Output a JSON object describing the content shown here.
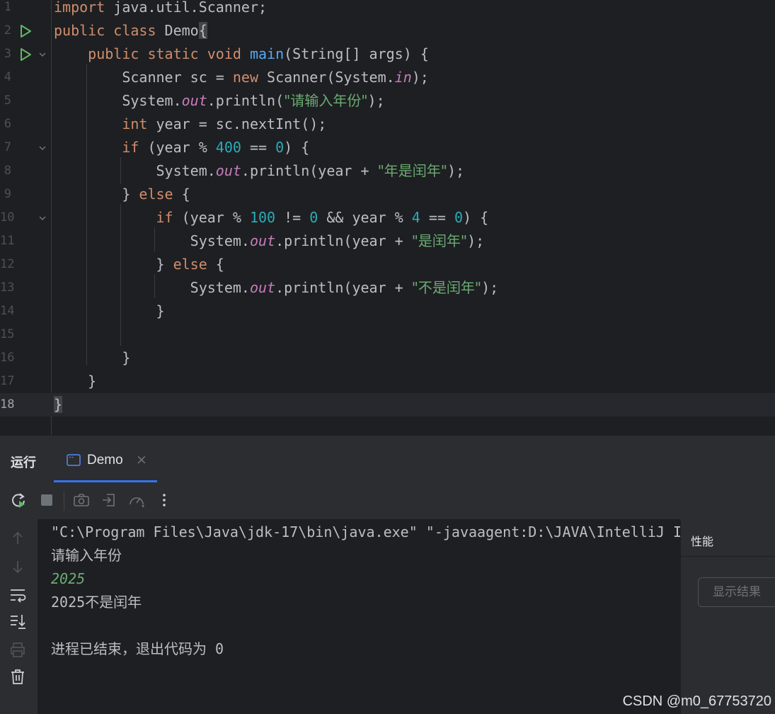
{
  "editor": {
    "lines": [
      {
        "num": "1"
      },
      {
        "num": "2"
      },
      {
        "num": "3"
      },
      {
        "num": "4"
      },
      {
        "num": "5"
      },
      {
        "num": "6"
      },
      {
        "num": "7"
      },
      {
        "num": "8"
      },
      {
        "num": "9"
      },
      {
        "num": "10"
      },
      {
        "num": "11"
      },
      {
        "num": "12"
      },
      {
        "num": "13"
      },
      {
        "num": "14"
      },
      {
        "num": "15"
      },
      {
        "num": "16"
      },
      {
        "num": "17"
      },
      {
        "num": "18"
      }
    ],
    "code": {
      "l1": {
        "kw": "import",
        "rest": " java.util.Scanner;"
      },
      "l2": {
        "kw": "public class",
        "name": " Demo",
        "brace": "{"
      },
      "l3": {
        "kw": "public static void",
        "fn": "main",
        "rest": "(String[] args) {"
      },
      "l4": {
        "a": "Scanner sc = ",
        "kw": "new",
        "b": " Scanner(System.",
        "sf": "in",
        "c": ");"
      },
      "l5": {
        "a": "System.",
        "sf": "out",
        "b": ".println(",
        "st": "\"请输入年份\"",
        "c": ");"
      },
      "l6": {
        "kw": "int",
        "rest": " year = sc.nextInt();"
      },
      "l7": {
        "kw": "if",
        "a": " (year % ",
        "n1": "400",
        "b": " == ",
        "n2": "0",
        "c": ") {"
      },
      "l8": {
        "a": "System.",
        "sf": "out",
        "b": ".println(year + ",
        "st": "\"年是闰年\"",
        "c": ");"
      },
      "l9": {
        "a": "} ",
        "kw": "else",
        "b": " {"
      },
      "l10": {
        "kw": "if",
        "a": " (year % ",
        "n1": "100",
        "b": " != ",
        "n2": "0",
        "c": " && year % ",
        "n3": "4",
        "d": " == ",
        "n4": "0",
        "e": ") {"
      },
      "l11": {
        "a": "System.",
        "sf": "out",
        "b": ".println(year + ",
        "st": "\"是闰年\"",
        "c": ");"
      },
      "l12": {
        "a": "} ",
        "kw": "else",
        "b": " {"
      },
      "l13": {
        "a": "System.",
        "sf": "out",
        "b": ".println(year + ",
        "st": "\"不是闰年\"",
        "c": ");"
      },
      "l14": {
        "a": "}"
      },
      "l16": {
        "a": "}"
      },
      "l17": {
        "a": "}"
      },
      "l18": {
        "a": "}"
      }
    }
  },
  "toolwindow": {
    "title": "运行",
    "tab": {
      "label": "Demo",
      "close": "×"
    },
    "toolbar": [
      "rerun-icon",
      "stop-icon",
      "camera-icon",
      "exit-icon",
      "profiler-icon",
      "more-icon"
    ],
    "side": [
      "up-arrow-icon",
      "down-arrow-icon",
      "soft-wrap-icon",
      "scroll-to-end-icon",
      "print-icon",
      "trash-icon"
    ]
  },
  "console": {
    "lines": [
      "\"C:\\Program Files\\Java\\jdk-17\\bin\\java.exe\" \"-javaagent:D:\\JAVA\\IntelliJ I",
      "请输入年份",
      "2025",
      "2025不是闰年",
      "",
      "进程已结束，退出代码为 0"
    ]
  },
  "perf": {
    "title": "性能",
    "button": "显示结果"
  },
  "watermark": "CSDN @m0_67753720",
  "colors": {
    "keyword": "#cf8e6d",
    "function": "#56a8f5",
    "string": "#6aab73",
    "number": "#2aacb8",
    "static_field": "#c77dbb",
    "accent": "#3574f0"
  }
}
